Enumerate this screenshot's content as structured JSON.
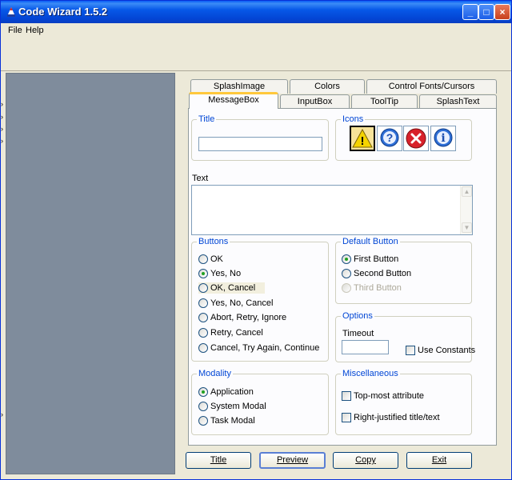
{
  "window": {
    "title": "Code Wizard 1.5.2",
    "minimize": "_",
    "maximize": "□",
    "close": "×"
  },
  "menu": [
    {
      "label": "File"
    },
    {
      "label": "Help"
    }
  ],
  "tabs_row1": [
    {
      "label": "SplashImage"
    },
    {
      "label": "Colors"
    },
    {
      "label": "Control Fonts/Cursors"
    }
  ],
  "tabs_row2": [
    {
      "label": "MessageBox",
      "active": true
    },
    {
      "label": "InputBox"
    },
    {
      "label": "ToolTip"
    },
    {
      "label": "SplashText"
    }
  ],
  "title_group": {
    "label": "Title",
    "value": ""
  },
  "icons_group": {
    "label": "Icons",
    "icons": [
      {
        "name": "warning-icon",
        "glyph": "!",
        "color": "#f5d400",
        "selected": true
      },
      {
        "name": "question-icon",
        "glyph": "?",
        "color": "#2f6fd6"
      },
      {
        "name": "error-icon",
        "glyph": "×",
        "color": "#d8222b"
      },
      {
        "name": "info-icon",
        "glyph": "i",
        "color": "#2f6fd6"
      }
    ]
  },
  "text_field": {
    "label": "Text",
    "value": ""
  },
  "buttons_group": {
    "label": "Buttons",
    "options": [
      {
        "label": "OK",
        "checked": false
      },
      {
        "label": "Yes, No",
        "checked": true
      },
      {
        "label": "OK, Cancel",
        "checked": false,
        "hover": true
      },
      {
        "label": "Yes, No, Cancel",
        "checked": false
      },
      {
        "label": "Abort, Retry, Ignore",
        "checked": false
      },
      {
        "label": "Retry, Cancel",
        "checked": false
      },
      {
        "label": "Cancel, Try Again, Continue",
        "checked": false
      }
    ]
  },
  "default_button_group": {
    "label": "Default Button",
    "options": [
      {
        "label": "First Button",
        "checked": true
      },
      {
        "label": "Second Button",
        "checked": false
      },
      {
        "label": "Third Button",
        "checked": false,
        "disabled": true
      }
    ]
  },
  "options_group": {
    "label": "Options",
    "timeout_label": "Timeout",
    "timeout_value": "",
    "use_constants": "Use Constants"
  },
  "modality_group": {
    "label": "Modality",
    "options": [
      {
        "label": "Application",
        "checked": true
      },
      {
        "label": "System Modal",
        "checked": false
      },
      {
        "label": "Task Modal",
        "checked": false
      }
    ]
  },
  "misc_group": {
    "label": "Miscellaneous",
    "topmost": "Top-most attribute",
    "rightjustified": "Right-justified title/text"
  },
  "bottom_buttons": [
    {
      "label": "Title",
      "mnemonic": "T"
    },
    {
      "label": "Preview",
      "mnemonic": "P",
      "default": true
    },
    {
      "label": "Copy",
      "mnemonic": "C"
    },
    {
      "label": "Exit",
      "mnemonic": "E"
    }
  ],
  "colors": {
    "titlebar": "#0a5cf5",
    "group_label": "#0046d5",
    "left_pane": "#7f8c9c",
    "active_tab_accent": "#ffc83c"
  }
}
